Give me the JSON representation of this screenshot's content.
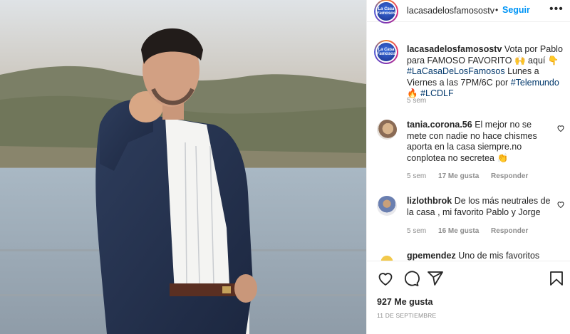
{
  "post": {
    "username": "lacasadelosfamosostv",
    "follow_label": "Seguir",
    "separator": "•",
    "more_label": "•••",
    "avatar_text": "La Casa Famosos"
  },
  "caption": {
    "username": "lacasadelosfamosostv",
    "text_1": "Vota por Pablo para FAMOSO FAVORITO",
    "emoji_1": "🙌",
    "text_2": "aquí",
    "emoji_2": "👇",
    "hashtag_1": "#LaCasaDeLosFamosos",
    "text_3": "Lunes a Viernes a las 7PM/6C por",
    "hashtag_2": "#Telemundo",
    "emoji_3": "🔥",
    "hashtag_3": "#LCDLF",
    "time": "5 sem"
  },
  "comments": [
    {
      "username": "tania.corona.56",
      "text": "El mejor no se mete con nadie no hace chismes aporta en la casa siempre.no conplotea no secretea",
      "emoji": "👏",
      "time": "5 sem",
      "likes": "17 Me gusta",
      "reply": "Responder"
    },
    {
      "username": "lizlothbrok",
      "text": "De los más neutrales de la casa , mi favorito Pablo y Jorge",
      "emoji": "",
      "time": "5 sem",
      "likes": "16 Me gusta",
      "reply": "Responder"
    },
    {
      "username": "gpemendez",
      "text": "Uno de mis favoritos",
      "emoji": "",
      "time": "",
      "likes": "",
      "reply": ""
    }
  ],
  "actions": {
    "icons": [
      "heart-icon",
      "comment-icon",
      "share-icon",
      "bookmark-icon"
    ],
    "likes_count": "927 Me gusta",
    "date": "11 DE SEPTIEMBRE"
  },
  "colors": {
    "accent": "#0095f6",
    "hashtag": "#00376b",
    "muted": "#8e8e8e",
    "text": "#262626"
  }
}
